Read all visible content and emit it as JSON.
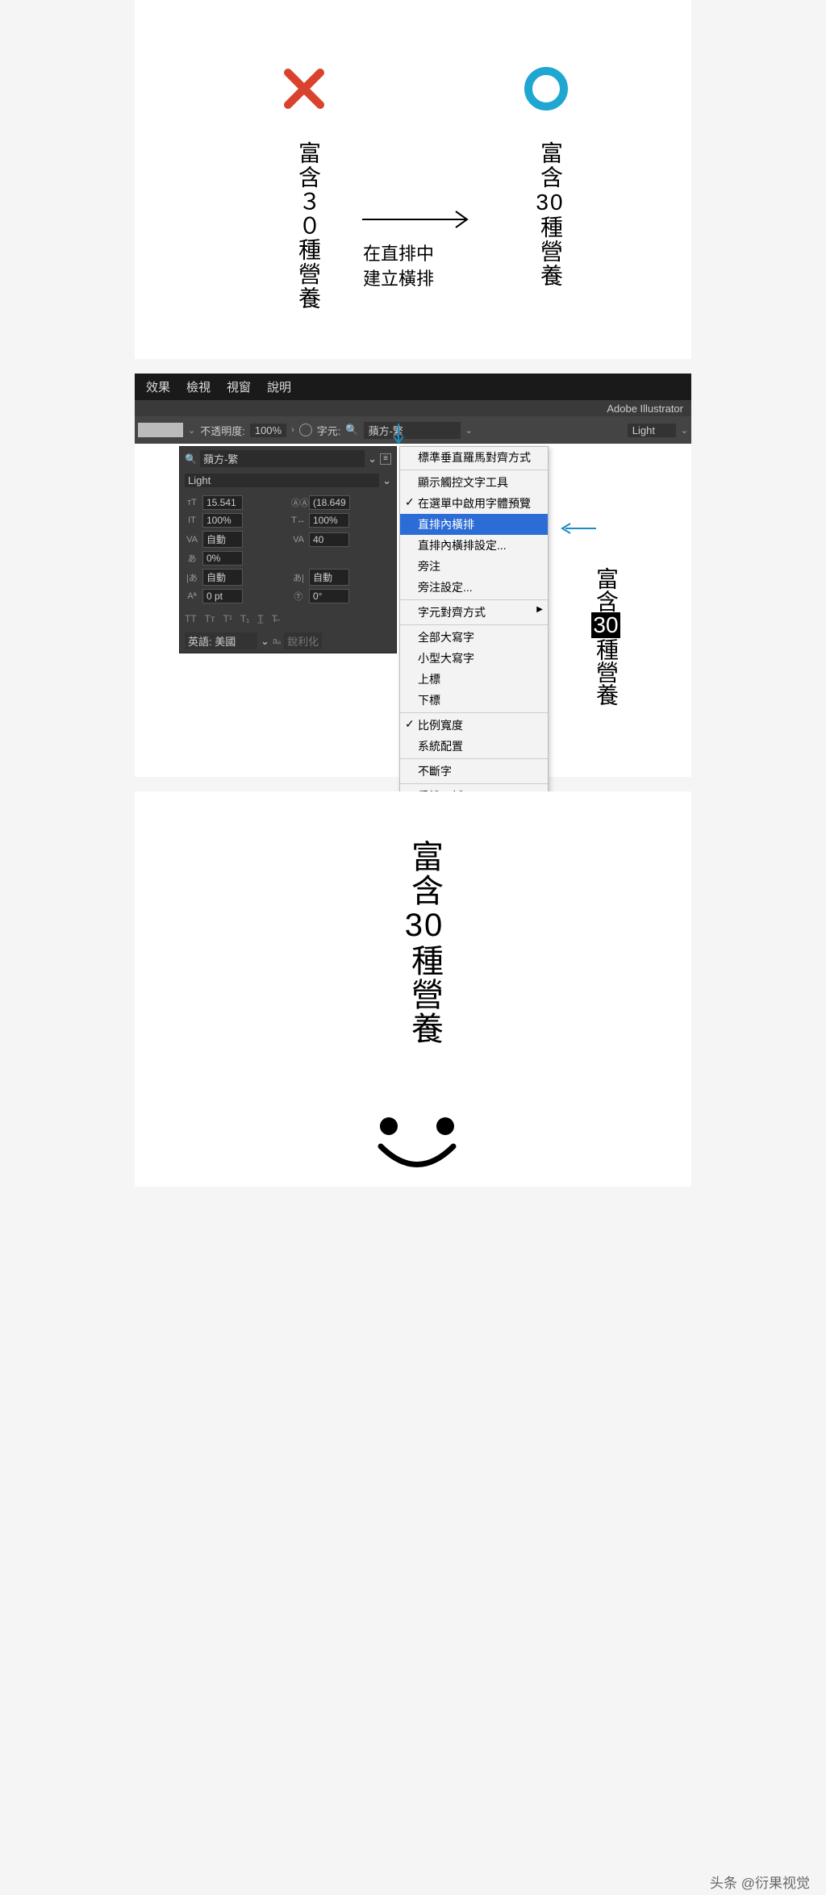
{
  "top": {
    "vertical_text": "富含３０種營養",
    "vertical_text_prefix": "富含",
    "vertical_text_num": "30",
    "vertical_text_suffix": "種營養",
    "caption_line1": "在直排中",
    "caption_line2": "建立橫排"
  },
  "menubar": {
    "items": [
      "效果",
      "檢視",
      "視窗",
      "說明"
    ]
  },
  "app_name": "Adobe Illustrator",
  "toolbar": {
    "opacity_label": "不透明度:",
    "opacity_value": "100%",
    "char_label": "字元:",
    "font_name": "蘋方-繁",
    "font_style": "Light"
  },
  "char_panel": {
    "search_prefix": "Q",
    "font_name": "蘋方-繁",
    "font_style": "Light",
    "size": "15.541",
    "leading": "(18.649",
    "vscale": "100%",
    "hscale": "100%",
    "kerning": "自動",
    "tracking": "40",
    "baseline": "0%",
    "tsume": "自動",
    "aki_left": "自動",
    "shift": "0 pt",
    "rotate": "0°",
    "lang_label": "英語: 美國",
    "aa_label": "銳利化"
  },
  "dropdown": {
    "items": [
      {
        "label": "標準垂直羅馬對齊方式",
        "sep_after": true
      },
      {
        "label": "顯示觸控文字工具"
      },
      {
        "label": "在選單中啟用字體預覽",
        "checked": true
      },
      {
        "label": "直排內橫排",
        "highlight": true
      },
      {
        "label": "直排內橫排設定..."
      },
      {
        "label": "旁注"
      },
      {
        "label": "旁注設定...",
        "sep_after": true
      },
      {
        "label": "字元對齊方式",
        "submenu": true,
        "sep_after": true
      },
      {
        "label": "全部大寫字"
      },
      {
        "label": "小型大寫字"
      },
      {
        "label": "上標"
      },
      {
        "label": "下標",
        "sep_after": true
      },
      {
        "label": "比例寬度",
        "checked": true
      },
      {
        "label": "系統配置",
        "sep_after": true
      },
      {
        "label": "不斷字",
        "sep_after": true
      },
      {
        "label": "重設面板"
      }
    ]
  },
  "sample": {
    "prefix": "富含",
    "num": "30",
    "suffix": "種營養"
  },
  "watermark": "头条 @衍果视觉"
}
